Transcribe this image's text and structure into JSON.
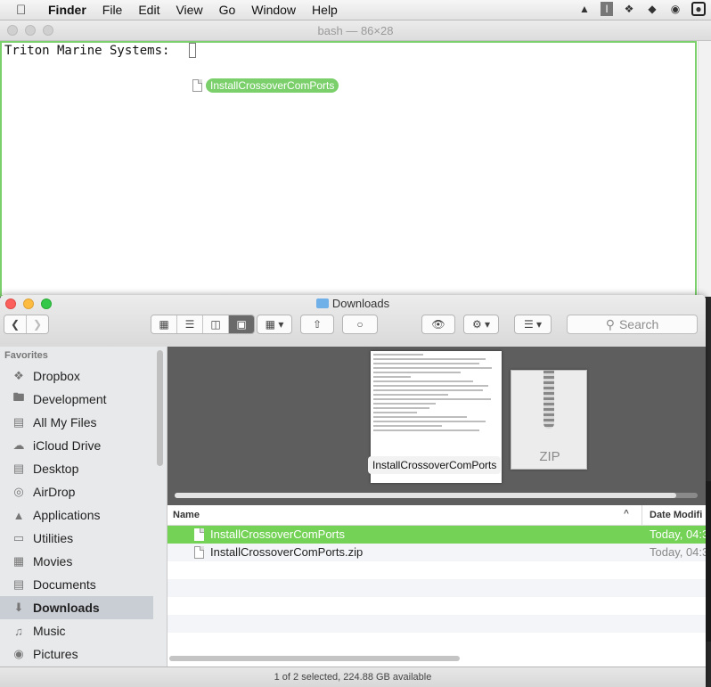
{
  "menubar": {
    "app_name": "Finder",
    "items": [
      "File",
      "Edit",
      "View",
      "Go",
      "Window",
      "Help"
    ]
  },
  "terminal": {
    "title": "bash — 86×28",
    "prompt": "Triton Marine Systems:",
    "dragged_file": "InstallCrossoverComPorts"
  },
  "finder": {
    "title": "Downloads",
    "search_placeholder": "Search",
    "sidebar": {
      "section": "Favorites",
      "items": [
        {
          "label": "Dropbox",
          "icon": "dropbox-icon"
        },
        {
          "label": "Development",
          "icon": "folder-icon"
        },
        {
          "label": "All My Files",
          "icon": "all-files-icon"
        },
        {
          "label": "iCloud Drive",
          "icon": "cloud-icon"
        },
        {
          "label": "Desktop",
          "icon": "desktop-icon"
        },
        {
          "label": "AirDrop",
          "icon": "airdrop-icon"
        },
        {
          "label": "Applications",
          "icon": "applications-icon"
        },
        {
          "label": "Utilities",
          "icon": "folder-icon"
        },
        {
          "label": "Movies",
          "icon": "movies-icon"
        },
        {
          "label": "Documents",
          "icon": "documents-icon"
        },
        {
          "label": "Downloads",
          "icon": "downloads-icon",
          "selected": true
        },
        {
          "label": "Music",
          "icon": "music-icon"
        },
        {
          "label": "Pictures",
          "icon": "pictures-icon"
        }
      ]
    },
    "coverflow": {
      "selected_label": "InstallCrossoverComPorts",
      "zip_label": "ZIP"
    },
    "columns": {
      "name": "Name",
      "date": "Date Modifi"
    },
    "files": [
      {
        "name": "InstallCrossoverComPorts",
        "date": "Today, 04:3",
        "selected": true
      },
      {
        "name": "InstallCrossoverComPorts.zip",
        "date": "Today, 04:3",
        "selected": false
      }
    ],
    "status": "1 of 2 selected, 224.88 GB available"
  }
}
